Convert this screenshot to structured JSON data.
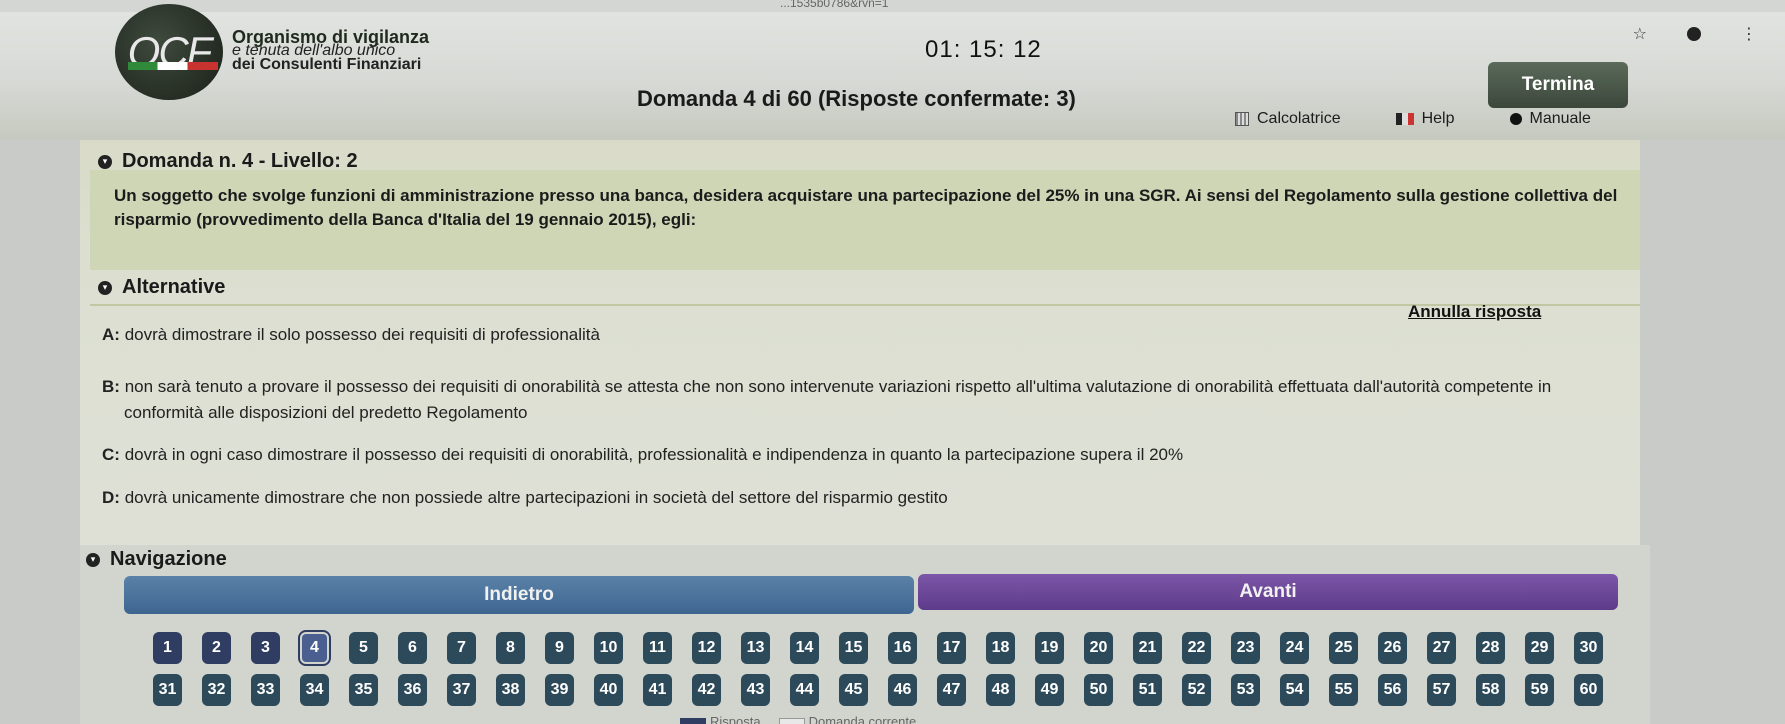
{
  "browser": {
    "url_fragment": "...1535b0786&rvn=1"
  },
  "header": {
    "logo_text": "OCF",
    "org_line1": "Organismo di vigilanza",
    "org_line2": "e tenuta dell'albo unico",
    "org_line3": "dei Consulenti Finanziari",
    "timer": "01: 15: 12",
    "question_counter": "Domanda 4 di 60 (Risposte confermate: 3)",
    "termina_label": "Termina",
    "tools": {
      "calc": "Calcolatrice",
      "help": "Help",
      "manual": "Manuale"
    }
  },
  "question": {
    "heading": "Domanda n. 4 - Livello: 2",
    "text": "Un soggetto che svolge funzioni di amministrazione presso una banca, desidera acquistare una partecipazione del 25% in una SGR. Ai sensi del Regolamento sulla gestione collettiva del risparmio (provvedimento della Banca d'Italia del 19 gennaio 2015), egli:"
  },
  "alternatives": {
    "heading": "Alternative",
    "annulla_label": "Annulla risposta",
    "items": [
      {
        "letter": "A:",
        "text": "dovrà dimostrare il solo possesso dei requisiti di professionalità",
        "text2": ""
      },
      {
        "letter": "B:",
        "text": "non sarà tenuto a provare il possesso dei requisiti di onorabilità se attesta che non sono intervenute variazioni rispetto all'ultima valutazione di onorabilità effettuata dall'autorità competente in",
        "text2": "conformità alle disposizioni del predetto Regolamento"
      },
      {
        "letter": "C:",
        "text": "dovrà in ogni caso dimostrare il possesso dei requisiti di onorabilità, professionalità e indipendenza in quanto la partecipazione supera il 20%",
        "text2": ""
      },
      {
        "letter": "D:",
        "text": "dovrà unicamente dimostrare che non possiede altre partecipazioni in società del settore del risparmio gestito",
        "text2": ""
      }
    ]
  },
  "navigation": {
    "heading": "Navigazione",
    "back_label": "Indietro",
    "next_label": "Avanti",
    "current": 4,
    "row1": [
      "1",
      "2",
      "3",
      "4",
      "5",
      "6",
      "7",
      "8",
      "9",
      "10",
      "11",
      "12",
      "13",
      "14",
      "15",
      "16",
      "17",
      "18",
      "19",
      "20",
      "21",
      "22",
      "23",
      "24",
      "25",
      "26",
      "27",
      "28",
      "29",
      "30"
    ],
    "row2": [
      "31",
      "32",
      "33",
      "34",
      "35",
      "36",
      "37",
      "38",
      "39",
      "40",
      "41",
      "42",
      "43",
      "44",
      "45",
      "46",
      "47",
      "48",
      "49",
      "50",
      "51",
      "52",
      "53",
      "54",
      "55",
      "56",
      "57",
      "58",
      "59",
      "60"
    ],
    "legend": {
      "answered": "Risposta",
      "current": "Domanda corrente"
    }
  }
}
